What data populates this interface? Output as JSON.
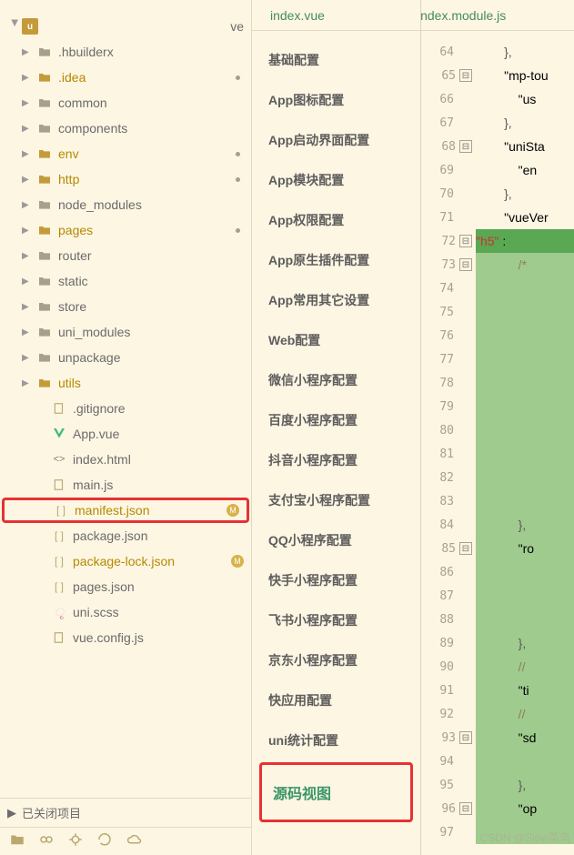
{
  "tabs": {
    "tab1": "index.vue",
    "tab2": "index.module.js"
  },
  "tree": {
    "root": {
      "name": "",
      "suffix": "ve"
    },
    "items": [
      {
        "name": ".hbuilderx",
        "type": "folder",
        "col": "gray"
      },
      {
        "name": ".idea",
        "type": "folder",
        "col": "brown",
        "dot": true
      },
      {
        "name": "common",
        "type": "folder",
        "col": "gray"
      },
      {
        "name": "components",
        "type": "folder",
        "col": "gray"
      },
      {
        "name": "env",
        "type": "folder",
        "col": "brown",
        "dot": true
      },
      {
        "name": "http",
        "type": "folder",
        "col": "brown",
        "dot": true
      },
      {
        "name": "node_modules",
        "type": "folder",
        "col": "gray"
      },
      {
        "name": "pages",
        "type": "folder",
        "col": "brown",
        "dot": true
      },
      {
        "name": "router",
        "type": "folder",
        "col": "gray"
      },
      {
        "name": "static",
        "type": "folder",
        "col": "gray"
      },
      {
        "name": "store",
        "type": "folder",
        "col": "gray"
      },
      {
        "name": "uni_modules",
        "type": "folder",
        "col": "gray"
      },
      {
        "name": "unpackage",
        "type": "folder",
        "col": "gray"
      },
      {
        "name": "utils",
        "type": "folder",
        "col": "brown"
      },
      {
        "name": ".gitignore",
        "type": "file",
        "icon": "txt"
      },
      {
        "name": "App.vue",
        "type": "file",
        "icon": "vue"
      },
      {
        "name": "index.html",
        "type": "file",
        "icon": "html"
      },
      {
        "name": "main.js",
        "type": "file",
        "icon": "js"
      },
      {
        "name": "manifest.json",
        "type": "file",
        "icon": "json",
        "col": "brown",
        "highlight": true,
        "badge": "M"
      },
      {
        "name": "package.json",
        "type": "file",
        "icon": "json"
      },
      {
        "name": "package-lock.json",
        "type": "file",
        "icon": "json",
        "col": "brown",
        "badge": "M"
      },
      {
        "name": "pages.json",
        "type": "file",
        "icon": "json"
      },
      {
        "name": "uni.scss",
        "type": "file",
        "icon": "scss"
      },
      {
        "name": "vue.config.js",
        "type": "file",
        "icon": "js"
      }
    ]
  },
  "footer": {
    "closed": "已关闭项目"
  },
  "config": {
    "items": [
      "基础配置",
      "App图标配置",
      "App启动界面配置",
      "App模块配置",
      "App权限配置",
      "App原生插件配置",
      "App常用其它设置",
      "Web配置",
      "微信小程序配置",
      "百度小程序配置",
      "抖音小程序配置",
      "支付宝小程序配置",
      "QQ小程序配置",
      "快手小程序配置",
      "飞书小程序配置",
      "京东小程序配置",
      "快应用配置",
      "uni统计配置"
    ],
    "source": "源码视图"
  },
  "code": {
    "start": 64,
    "lines": [
      {
        "n": 64,
        "t": "        },",
        "cls": ""
      },
      {
        "n": 65,
        "t": "        \"mp-tou",
        "fold": "-",
        "key": true
      },
      {
        "n": 66,
        "t": "            \"us",
        "key": true
      },
      {
        "n": 67,
        "t": "        },",
        "cls": ""
      },
      {
        "n": 68,
        "t": "        \"uniSta",
        "fold": "-",
        "key": true
      },
      {
        "n": 69,
        "t": "            \"en",
        "key": true
      },
      {
        "n": 70,
        "t": "        },",
        "cls": ""
      },
      {
        "n": 71,
        "t": "        \"vueVer",
        "key": true
      },
      {
        "n": 72,
        "t": "        \"h5\" : ",
        "fold": "-",
        "hl": "strong",
        "key": true
      },
      {
        "n": 73,
        "t": "            /*",
        "fold": "-",
        "hl": true,
        "cmt": true
      },
      {
        "n": 74,
        "t": " ",
        "hl": true
      },
      {
        "n": 75,
        "t": " ",
        "hl": true
      },
      {
        "n": 76,
        "t": " ",
        "hl": true
      },
      {
        "n": 77,
        "t": " ",
        "hl": true
      },
      {
        "n": 78,
        "t": " ",
        "hl": true
      },
      {
        "n": 79,
        "t": " ",
        "hl": true
      },
      {
        "n": 80,
        "t": " ",
        "hl": true
      },
      {
        "n": 81,
        "t": " ",
        "hl": true
      },
      {
        "n": 82,
        "t": " ",
        "hl": true
      },
      {
        "n": 83,
        "t": " ",
        "hl": true
      },
      {
        "n": 84,
        "t": "            },",
        "hl": true
      },
      {
        "n": 85,
        "t": "            \"ro",
        "fold": "-",
        "hl": true,
        "key": true
      },
      {
        "n": 86,
        "t": " ",
        "hl": true
      },
      {
        "n": 87,
        "t": " ",
        "hl": true
      },
      {
        "n": 88,
        "t": " ",
        "hl": true
      },
      {
        "n": 89,
        "t": "            },",
        "hl": true
      },
      {
        "n": 90,
        "t": "            //",
        "hl": true,
        "cmt": true
      },
      {
        "n": 91,
        "t": "            \"ti",
        "hl": true,
        "key": true
      },
      {
        "n": 92,
        "t": "            //",
        "hl": true,
        "cmt": true
      },
      {
        "n": 93,
        "t": "            \"sd",
        "fold": "-",
        "hl": true,
        "key": true
      },
      {
        "n": 94,
        "t": " ",
        "hl": true
      },
      {
        "n": 95,
        "t": "            },",
        "hl": true
      },
      {
        "n": 96,
        "t": "            \"op",
        "fold": "-",
        "hl": true,
        "key": true
      },
      {
        "n": 97,
        "t": " ",
        "hl": true
      }
    ]
  },
  "watermark": "CSDN @Slow菜鸟"
}
